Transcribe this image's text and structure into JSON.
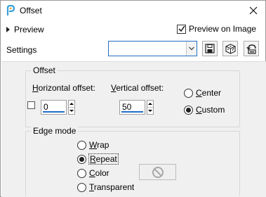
{
  "window": {
    "title": "Offset"
  },
  "preview": {
    "label": "Preview",
    "on_image_label": "Preview on Image",
    "on_image_checked": true
  },
  "settings": {
    "label": "Settings",
    "value": ""
  },
  "offset_group": {
    "title": "Offset",
    "horizontal_label_first": "H",
    "horizontal_label_rest": "orizontal offset:",
    "horizontal_value": "0",
    "vertical_label_first": "V",
    "vertical_label_rest": "ertical offset:",
    "vertical_value": "50",
    "center_first": "C",
    "center_rest": "enter",
    "custom_first": "C",
    "custom_rest": "ustom",
    "selected": "custom"
  },
  "edge_mode": {
    "title": "Edge mode",
    "wrap_first": "W",
    "wrap_rest": "rap",
    "repeat_first": "R",
    "repeat_rest": "epeat",
    "color_first": "C",
    "color_rest": "olor",
    "transparent_first": "T",
    "transparent_rest": "ransparent",
    "selected": "repeat"
  },
  "colors": {
    "accent": "#1f6fc6",
    "panel_bg": "#f0f0f0",
    "icon_blue": "#3aa0d8"
  },
  "icons": [
    "app-icon",
    "close-icon",
    "save-icon",
    "random-icon",
    "reset-icon",
    "no-color-icon"
  ]
}
